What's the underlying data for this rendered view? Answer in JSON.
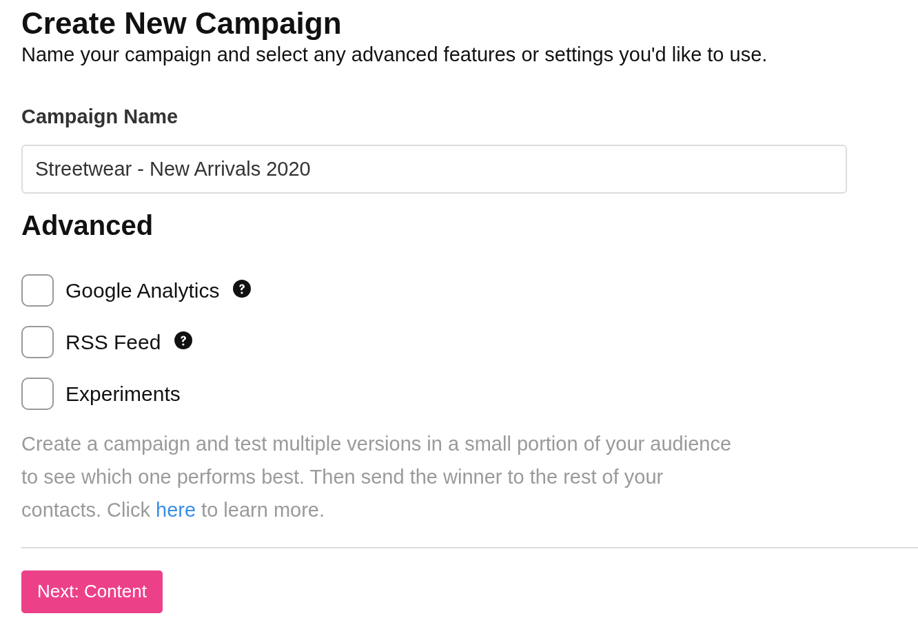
{
  "title": "Create New Campaign",
  "subtitle": "Name your campaign and select any advanced features or settings you'd like to use.",
  "campaign_name": {
    "label": "Campaign Name",
    "value": "Streetwear - New Arrivals 2020"
  },
  "advanced": {
    "heading": "Advanced",
    "options": [
      {
        "label": "Google Analytics",
        "checked": false,
        "help": true
      },
      {
        "label": "RSS Feed",
        "checked": false,
        "help": true
      },
      {
        "label": "Experiments",
        "checked": false,
        "help": false
      }
    ],
    "description": {
      "text_before": "Create a campaign and test multiple versions in a small portion of your audience to see which one performs best. Then send the winner to the rest of your contacts. Click ",
      "link": "here",
      "text_after": " to learn more."
    }
  },
  "next_button": "Next: Content"
}
